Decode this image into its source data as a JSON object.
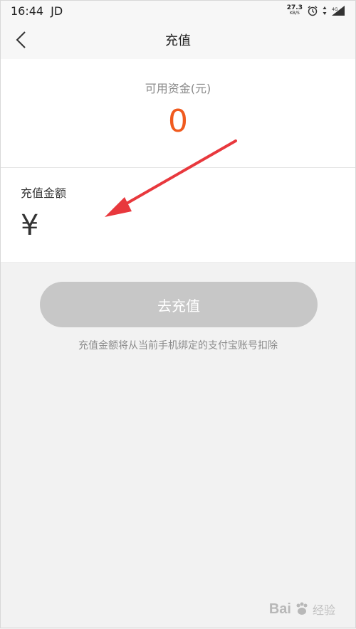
{
  "status_bar": {
    "time": "16:44",
    "carrier": "JD",
    "net_speed_value": "27.3",
    "net_speed_unit": "KB/S",
    "network_type": "4G",
    "icons": [
      "alarm-icon",
      "data-arrows-icon",
      "signal-icon"
    ]
  },
  "nav": {
    "title": "充值",
    "back_icon": "chevron-left-icon"
  },
  "balance": {
    "label": "可用资金(元)",
    "value": "0"
  },
  "amount": {
    "label": "充值金额",
    "currency_symbol": "¥",
    "input_value": "",
    "input_placeholder": ""
  },
  "action": {
    "button_label": "去充值",
    "note": "充值金额将从当前手机绑定的支付宝账号扣除"
  },
  "annotation": {
    "arrow_color": "#e8383d"
  },
  "watermark": {
    "logo_text": "Bai",
    "suffix_text": "经验"
  },
  "colors": {
    "accent": "#f05a1e",
    "button_disabled": "#c7c7c7",
    "background": "#f2f2f2"
  }
}
